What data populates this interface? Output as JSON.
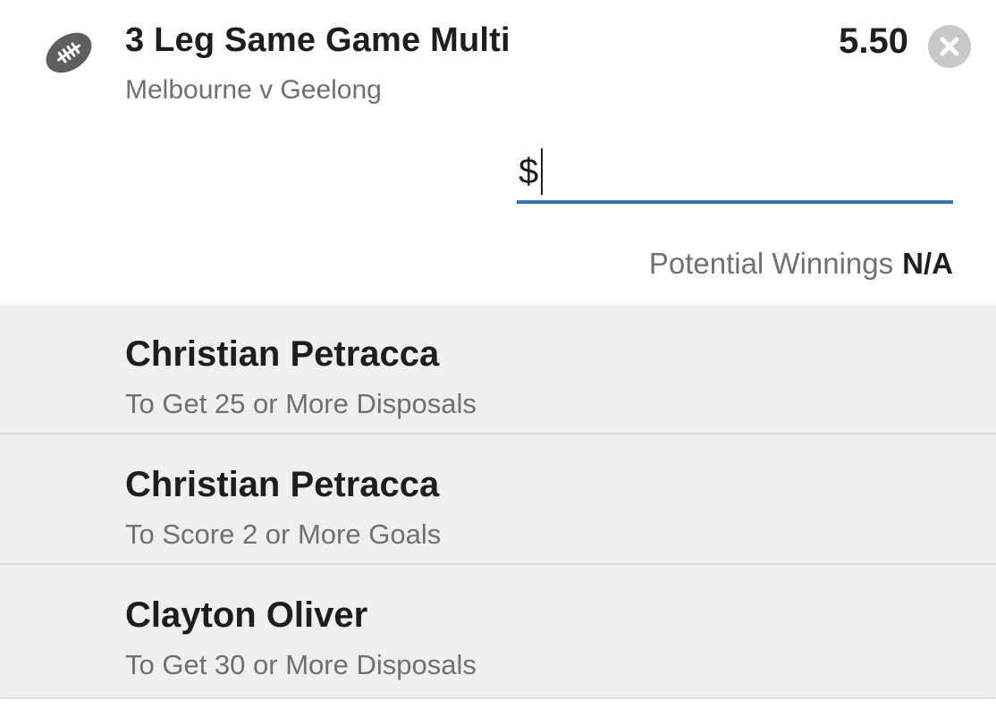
{
  "bet": {
    "title": "3 Leg Same Game Multi",
    "event": "Melbourne v Geelong",
    "odds": "5.50",
    "sport_icon": "football-icon",
    "remove_icon": "close-icon"
  },
  "stake": {
    "prefix": "$",
    "value": "",
    "placeholder": ""
  },
  "winnings": {
    "label": "Potential Winnings",
    "value": "N/A"
  },
  "legs": [
    {
      "player": "Christian Petracca",
      "market": "To Get 25 or More Disposals"
    },
    {
      "player": "Christian Petracca",
      "market": "To Score 2 or More Goals"
    },
    {
      "player": "Clayton Oliver",
      "market": "To Get 30 or More Disposals"
    }
  ],
  "colors": {
    "accent": "#3a72b8",
    "text_primary": "#1e1e1e",
    "text_secondary": "#707070",
    "legs_background": "#efefef",
    "icon_grey": "#5f5f5f",
    "close_background": "#c8c8c8"
  }
}
